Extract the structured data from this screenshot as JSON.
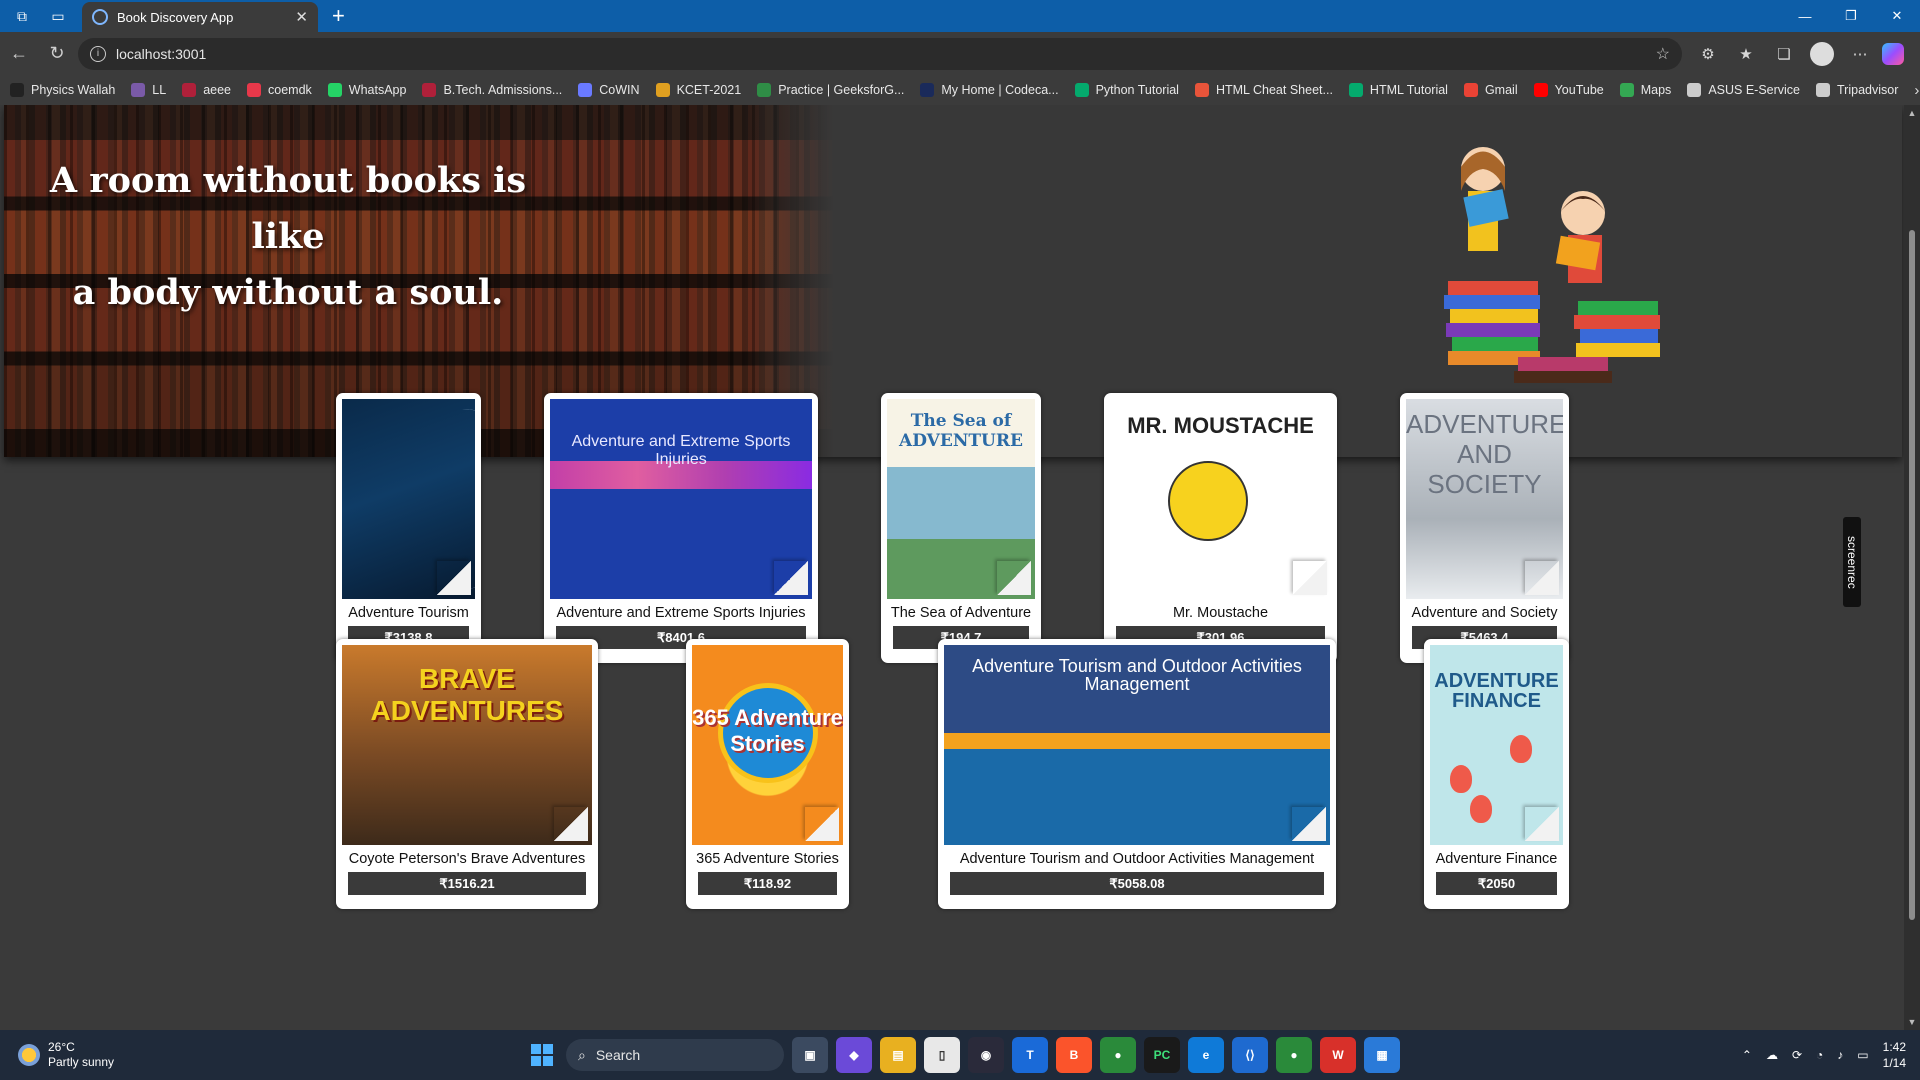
{
  "browser": {
    "tab_title": "Book Discovery App",
    "url": "localhost:3001",
    "bookmarks": [
      {
        "label": "Physics Wallah",
        "color": "#222222"
      },
      {
        "label": "LL",
        "color": "#7a5aa8"
      },
      {
        "label": "aeee",
        "color": "#b0203a"
      },
      {
        "label": "coemdk",
        "color": "#e8384a"
      },
      {
        "label": "WhatsApp",
        "color": "#25d366"
      },
      {
        "label": "B.Tech. Admissions...",
        "color": "#b0203a"
      },
      {
        "label": "CoWIN",
        "color": "#6a7aff"
      },
      {
        "label": "KCET-2021",
        "color": "#e0a020"
      },
      {
        "label": "Practice | GeeksforG...",
        "color": "#2f8d46"
      },
      {
        "label": "My Home | Codeca...",
        "color": "#1a2a5a"
      },
      {
        "label": "Python Tutorial",
        "color": "#04aa6d"
      },
      {
        "label": "HTML Cheat Sheet...",
        "color": "#e8543a"
      },
      {
        "label": "HTML Tutorial",
        "color": "#04aa6d"
      },
      {
        "label": "Gmail",
        "color": "#ea4335"
      },
      {
        "label": "YouTube",
        "color": "#ff0000"
      },
      {
        "label": "Maps",
        "color": "#34a853"
      },
      {
        "label": "ASUS E-Service",
        "color": "#cccccc"
      },
      {
        "label": "Tripadvisor",
        "color": "#cccccc"
      }
    ]
  },
  "hero": {
    "quote_line1": "A room without books is like",
    "quote_line2": "a body without a soul."
  },
  "books": [
    {
      "title": "Adventure Tourism",
      "price": "₹3138.8"
    },
    {
      "title": "Adventure and Extreme Sports Injuries",
      "price": "₹8401.6"
    },
    {
      "title": "The Sea of Adventure",
      "price": "₹194.7"
    },
    {
      "title": "Mr. Moustache",
      "price": "₹301.96"
    },
    {
      "title": "Adventure and Society",
      "price": "₹5463.4"
    },
    {
      "title": "Coyote Peterson's Brave Adventures",
      "price": "₹1516.21"
    },
    {
      "title": "365 Adventure Stories",
      "price": "₹118.92"
    },
    {
      "title": "Adventure Tourism and Outdoor Activities Management",
      "price": "₹5058.08"
    },
    {
      "title": "Adventure Finance",
      "price": "₹2050"
    }
  ],
  "covers": {
    "extreme_title": "Adventure and Extreme Sports Injuries",
    "sea_title": "The Sea of ADVENTURE",
    "mr_title": "MR. MOUSTACHE",
    "society_title": "ADVENTURE AND SOCIETY",
    "brave_title": "BRAVE ADVENTURES",
    "stories_title": "365 Adventure Stories",
    "outdoor_title": "Adventure Tourism and Outdoor Activities Management",
    "finance_title": "ADVENTURE FINANCE"
  },
  "overlay": {
    "screenrec": "screenrec"
  },
  "taskbar": {
    "temperature": "26°C",
    "weather": "Partly sunny",
    "search_placeholder": "Search",
    "time": "1:42",
    "date": "1/14"
  }
}
